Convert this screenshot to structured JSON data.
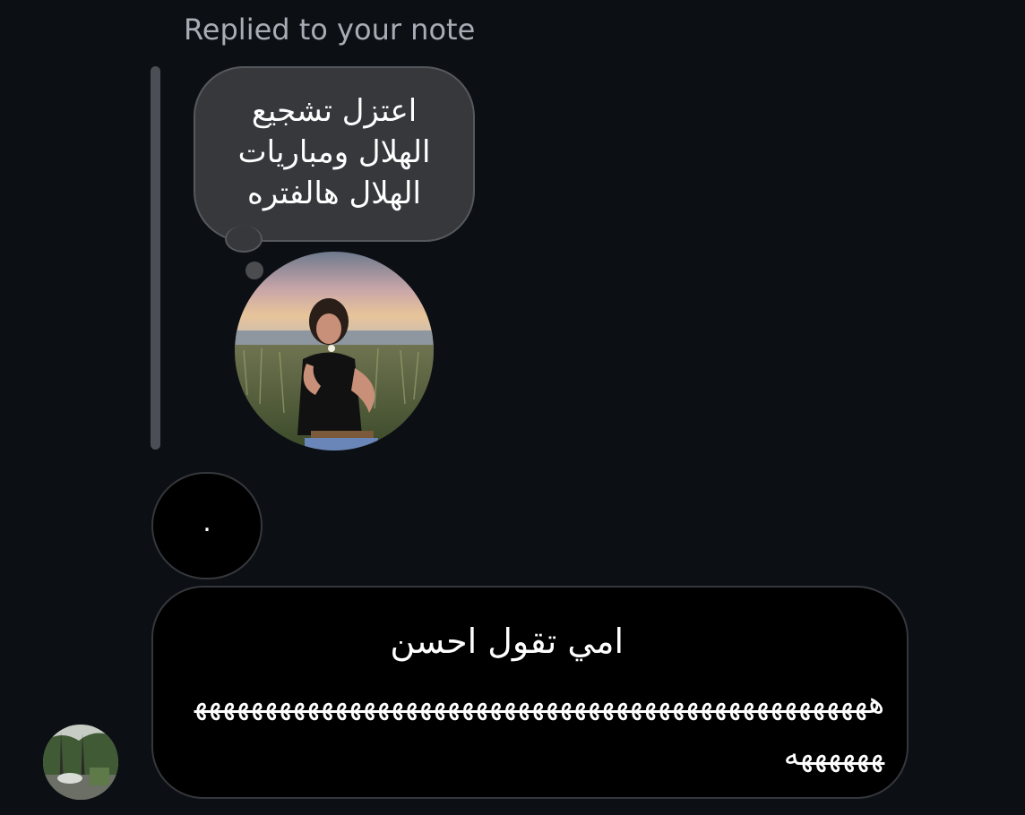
{
  "header": {
    "replied_label": "Replied to your note"
  },
  "note": {
    "text": "اعتزل تشجيع الهلال ومباريات الهلال هالفتره",
    "avatar_icon": "profile-photo-icon"
  },
  "messages": [
    {
      "text": "."
    },
    {
      "line1": "امي تقول احسن",
      "laugh": "هههههههههههههههههههههههههههههههههههههههههههههههههههههههه"
    }
  ],
  "sender": {
    "avatar_icon": "sender-avatar-icon"
  },
  "colors": {
    "background": "#0c1014",
    "note_bubble": "#36383c",
    "message_bubble": "#000000",
    "muted_text": "#a8adb5"
  }
}
